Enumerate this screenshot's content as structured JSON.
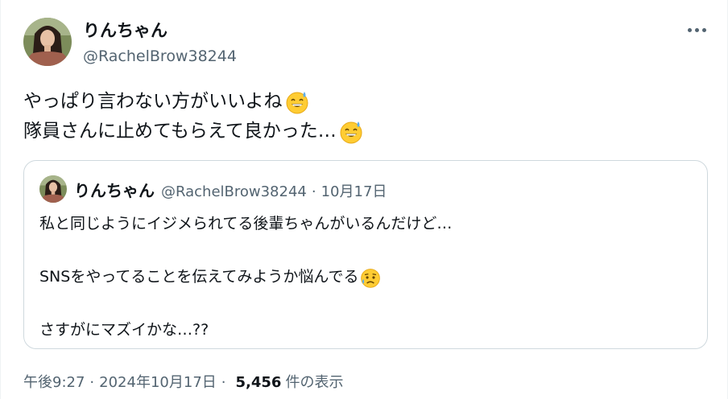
{
  "author": {
    "display_name": "りんちゃん",
    "handle": "@RachelBrow38244"
  },
  "tweet": {
    "lines": [
      "やっぱり言わない方がいいよね",
      "隊員さんに止めてもらえて良かった…"
    ],
    "emoji": "grinning-face-with-sweat"
  },
  "quoted_tweet": {
    "display_name": "りんちゃん",
    "handle": "@RachelBrow38244",
    "separator": "·",
    "date": "10月17日",
    "line1": "私と同じようにイジメられてる後輩ちゃんがいるんだけど…",
    "line2": "SNSをやってることを伝えてみようか悩んでる",
    "line2_emoji": "sad-but-relieved-face",
    "line3": "さすがにマズイかな…??"
  },
  "meta": {
    "time": "午後9:27",
    "dot1": "·",
    "date": "2024年10月17日",
    "dot2": "·",
    "views": "5,456",
    "views_label": "件の表示"
  }
}
